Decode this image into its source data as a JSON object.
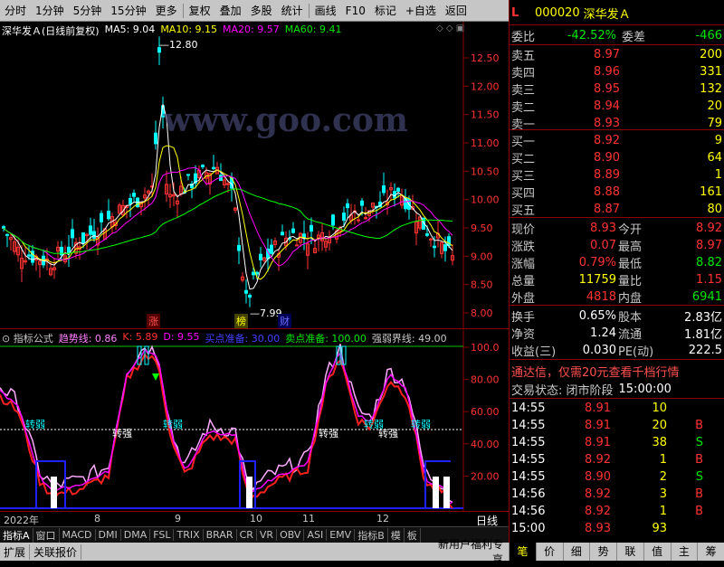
{
  "toolbar": {
    "items": [
      "分时",
      "1分钟",
      "5分钟",
      "15分钟",
      "更多",
      "复权",
      "叠加",
      "多股",
      "统计",
      "画线",
      "F10",
      "标记",
      "+自选",
      "返回"
    ]
  },
  "watermark": "www.goo.com",
  "main_chart": {
    "title": "深华发Ａ(日线前复权)",
    "ma5": "MA5: 9.04",
    "ma10": "MA10: 9.15",
    "ma20": "MA20: 9.57",
    "ma60": "MA60: 9.41",
    "high_label": "12.80",
    "low_label": "7.99",
    "tags": [
      "涨",
      "榜",
      "财"
    ],
    "y_ticks": [
      "12.50",
      "12.00",
      "11.50",
      "11.00",
      "10.50",
      "10.00",
      "9.50",
      "9.00",
      "8.50",
      "8.00"
    ],
    "colors": {
      "ma5": "#ffffff",
      "ma10": "#ffff00",
      "ma20": "#ff00ff",
      "ma60": "#00ff00"
    }
  },
  "indicator": {
    "title": "指标公式",
    "trend": "趋势线: 0.86",
    "k": "K: 5.89",
    "d": "D: 9.55",
    "buy": "买点准备: 30.00",
    "sell": "卖点准备: 100.00",
    "strongweak": "强弱界线: 49.00",
    "y_ticks": [
      "100.0",
      "80.00",
      "60.00",
      "40.00",
      "20.00"
    ],
    "labels": [
      "转弱",
      "转强",
      "转弱",
      "转强",
      "转弱",
      "转强",
      "转弱"
    ]
  },
  "x_axis": {
    "labels": [
      "2022年",
      "8",
      "9",
      "10",
      "11",
      "12"
    ],
    "period": "日线"
  },
  "tabs": [
    "指标A",
    "窗口",
    "MACD",
    "DMI",
    "DMA",
    "FSL",
    "TRIX",
    "BRAR",
    "CR",
    "VR",
    "OBV",
    "ASI",
    "EMV",
    "指标B",
    "模",
    "板"
  ],
  "bottom": {
    "left": [
      "扩展",
      "关联报价"
    ],
    "news": "新用户福利专享",
    "right": [
      "笔",
      "价",
      "细",
      "势",
      "联",
      "值",
      "主",
      "筹"
    ]
  },
  "quote": {
    "flag": "L",
    "code": "000020",
    "name": "深华发Ａ",
    "weibi_label": "委比",
    "weibi": "-42.52%",
    "weicha_label": "委差",
    "weicha": "-466",
    "sells": [
      {
        "label": "卖五",
        "price": "8.97",
        "vol": "200"
      },
      {
        "label": "卖四",
        "price": "8.96",
        "vol": "331"
      },
      {
        "label": "卖三",
        "price": "8.95",
        "vol": "132"
      },
      {
        "label": "卖二",
        "price": "8.94",
        "vol": "20"
      },
      {
        "label": "卖一",
        "price": "8.93",
        "vol": "79"
      }
    ],
    "buys": [
      {
        "label": "买一",
        "price": "8.92",
        "vol": "9"
      },
      {
        "label": "买二",
        "price": "8.90",
        "vol": "64"
      },
      {
        "label": "买三",
        "price": "8.89",
        "vol": "1"
      },
      {
        "label": "买四",
        "price": "8.88",
        "vol": "161"
      },
      {
        "label": "买五",
        "price": "8.87",
        "vol": "80"
      }
    ],
    "stats": [
      {
        "l1": "现价",
        "v1": "8.93",
        "c1": "red",
        "l2": "今开",
        "v2": "8.92",
        "c2": "red"
      },
      {
        "l1": "涨跌",
        "v1": "0.07",
        "c1": "red",
        "l2": "最高",
        "v2": "8.97",
        "c2": "red"
      },
      {
        "l1": "涨幅",
        "v1": "0.79%",
        "c1": "red",
        "l2": "最低",
        "v2": "8.82",
        "c2": "grn"
      },
      {
        "l1": "总量",
        "v1": "11759",
        "c1": "yel",
        "l2": "量比",
        "v2": "1.15",
        "c2": "red"
      },
      {
        "l1": "外盘",
        "v1": "4818",
        "c1": "red",
        "l2": "内盘",
        "v2": "6941",
        "c2": "grn"
      }
    ],
    "stats2": [
      {
        "l1": "换手",
        "v1": "0.65%",
        "l2": "股本",
        "v2": "2.83亿"
      },
      {
        "l1": "净资",
        "v1": "1.24",
        "l2": "流通",
        "v2": "1.81亿"
      },
      {
        "l1": "收益(三)",
        "v1": "0.030",
        "l2": "PE(动)",
        "v2": "222.5"
      }
    ],
    "ad": "通达信，仅需20元查看千档行情",
    "status_label": "交易状态: 闭市阶段",
    "status_time": "15:00:00",
    "ticks": [
      {
        "t": "14:55",
        "p": "8.91",
        "v": "10",
        "f": "",
        "pc": "red"
      },
      {
        "t": "14:55",
        "p": "8.91",
        "v": "20",
        "f": "B",
        "pc": "red"
      },
      {
        "t": "14:55",
        "p": "8.91",
        "v": "38",
        "f": "S",
        "pc": "red"
      },
      {
        "t": "14:55",
        "p": "8.92",
        "v": "1",
        "f": "B",
        "pc": "red"
      },
      {
        "t": "14:55",
        "p": "8.90",
        "v": "2",
        "f": "S",
        "pc": "red"
      },
      {
        "t": "14:56",
        "p": "8.92",
        "v": "3",
        "f": "B",
        "pc": "red"
      },
      {
        "t": "14:56",
        "p": "8.92",
        "v": "1",
        "f": "B",
        "pc": "red"
      },
      {
        "t": "15:00",
        "p": "8.93",
        "v": "93",
        "f": "",
        "pc": "red"
      }
    ]
  }
}
